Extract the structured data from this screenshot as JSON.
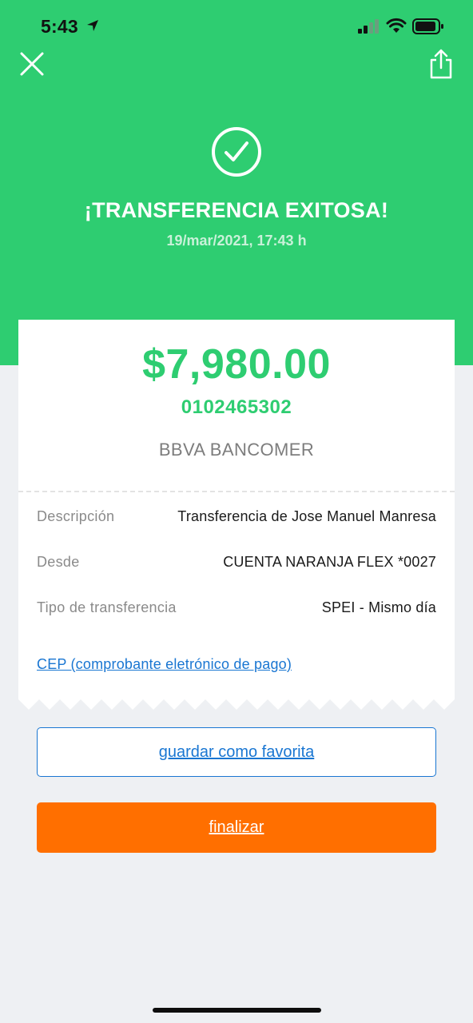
{
  "status_bar": {
    "time": "5:43",
    "icons": [
      "location-arrow-icon",
      "cellular-signal-icon",
      "wifi-icon",
      "battery-icon"
    ]
  },
  "header": {
    "close_icon": "close-icon",
    "share_icon": "share-icon",
    "success_icon": "check-circle-icon",
    "title": "¡TRANSFERENCIA EXITOSA!",
    "date": "19/mar/2021, 17:43 h"
  },
  "summary": {
    "amount": "$7,980.00",
    "account": "0102465302",
    "bank": "BBVA BANCOMER"
  },
  "details": [
    {
      "label": "Descripción",
      "value": "Transferencia de Jose Manuel Manresa"
    },
    {
      "label": "Desde",
      "value": "CUENTA NARANJA FLEX *0027"
    },
    {
      "label": "Tipo de transferencia",
      "value": "SPEI - Mismo día"
    }
  ],
  "cep_link": "CEP (comprobante eletrónico de pago)",
  "actions": {
    "favorite_label": "guardar como favorita",
    "finish_label": "finalizar"
  },
  "colors": {
    "brand_green": "#2ecd71",
    "link_blue": "#1976d2",
    "primary_orange": "#ff6f00",
    "background": "#eef0f3"
  }
}
